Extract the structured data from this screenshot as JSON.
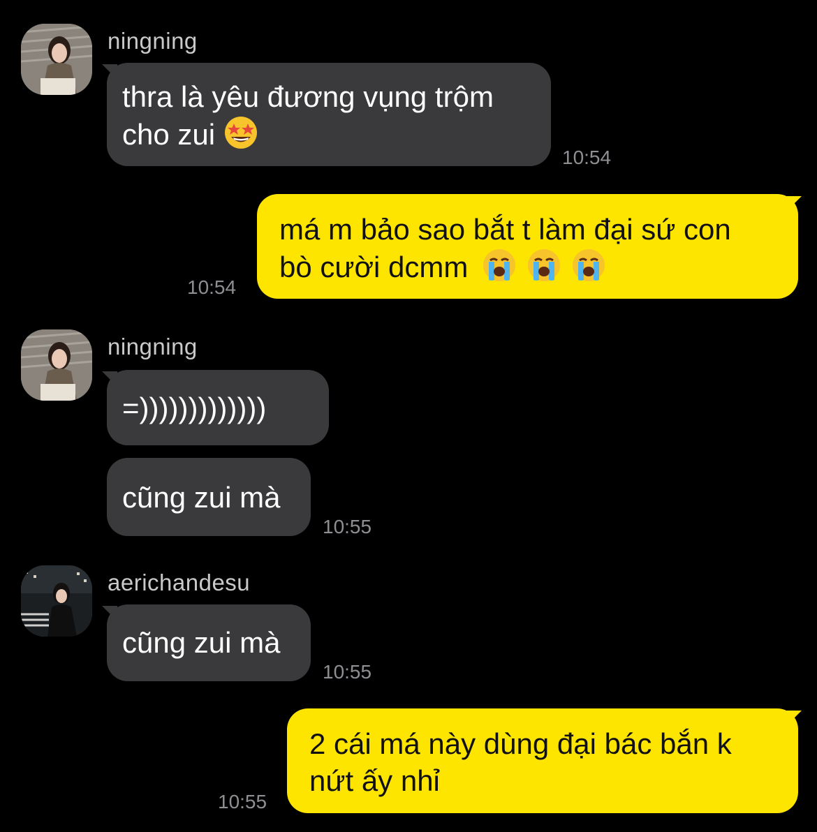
{
  "messages": [
    {
      "sender": "ningning",
      "text_line1": "thra là yêu đương vụng trộm",
      "text_line2": "cho zui",
      "emoji": "star-struck-emoji",
      "time": "10:54"
    },
    {
      "sender": "me",
      "text_line1": "má m bảo sao bắt t làm đại sứ con",
      "text_line2": "bò cười dcmm",
      "emoji": "loudly-crying-emoji",
      "emoji_count": 3,
      "time": "10:54"
    },
    {
      "sender": "ningning",
      "text": "=)))))))))))))",
      "time": ""
    },
    {
      "sender": "ningning",
      "text": "cũng zui mà",
      "time": "10:55"
    },
    {
      "sender": "aerichandesu",
      "text": "cũng zui mà",
      "time": "10:55"
    },
    {
      "sender": "me",
      "text_line1": "2 cái má này dùng đại bác bắn k",
      "text_line2": "nứt ấy nhỉ",
      "time": "10:55"
    }
  ],
  "names": {
    "user1": "ningning",
    "user2": "aerichandesu"
  },
  "colors": {
    "incoming": "#3a3a3c",
    "outgoing": "#fee500",
    "background": "#000000"
  }
}
